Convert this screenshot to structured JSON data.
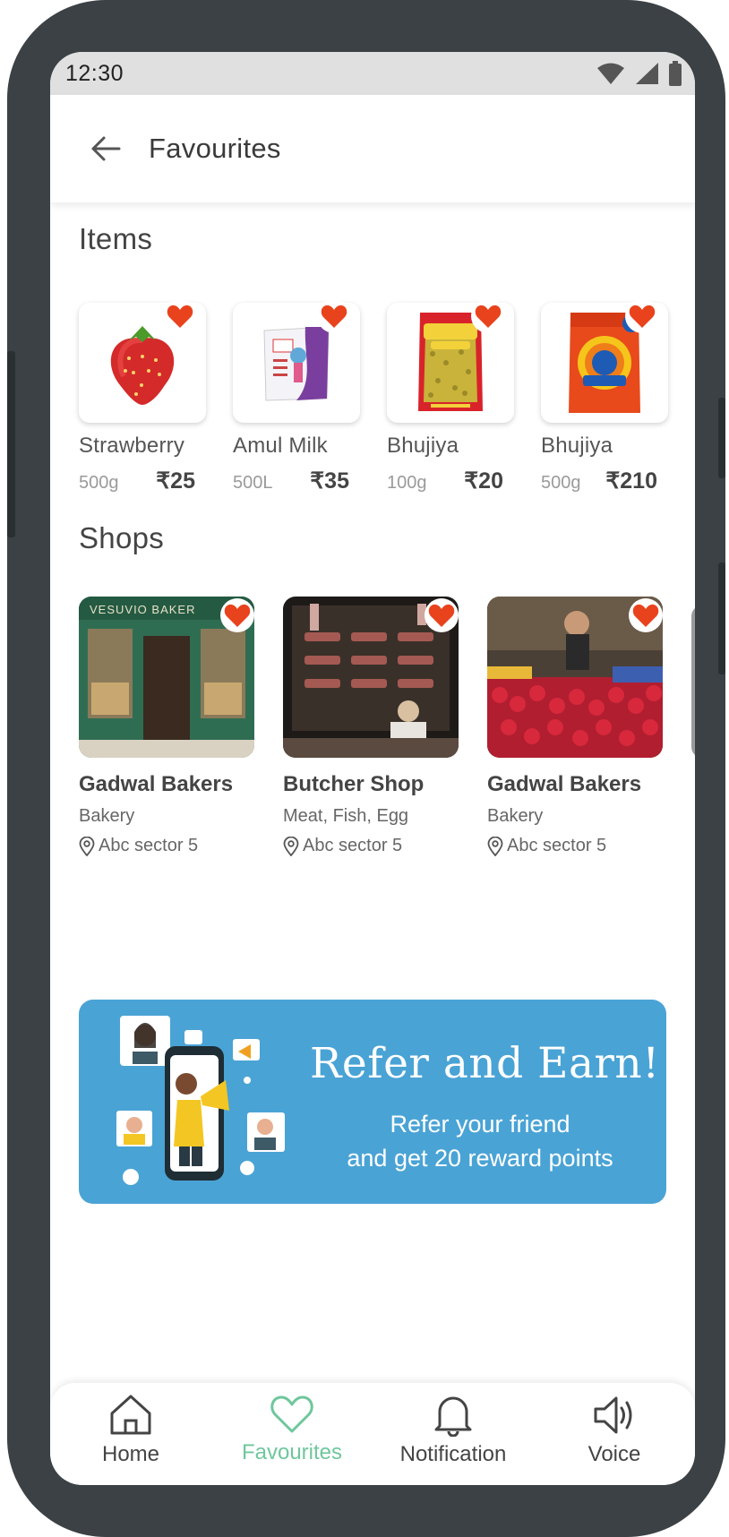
{
  "status_bar": {
    "time": "12:30"
  },
  "header": {
    "title": "Favourites"
  },
  "sections": {
    "items_title": "Items",
    "shops_title": "Shops"
  },
  "items": [
    {
      "name": "Strawberry",
      "qty": "500g",
      "price": "₹25"
    },
    {
      "name": "Amul Milk",
      "qty": "500L",
      "price": "₹35"
    },
    {
      "name": "Bhujiya",
      "qty": "100g",
      "price": "₹20"
    },
    {
      "name": "Bhujiya",
      "qty": "500g",
      "price": "₹210"
    }
  ],
  "shops": [
    {
      "name": "Gadwal Bakers",
      "category": "Bakery",
      "location": "Abc sector 5",
      "sign": "VESUVIO BAKER"
    },
    {
      "name": "Butcher Shop",
      "category": "Meat, Fish, Egg",
      "location": "Abc sector 5"
    },
    {
      "name": "Gadwal Bakers",
      "category": "Bakery",
      "location": "Abc sector 5"
    }
  ],
  "banner": {
    "title": "Refer and Earn!",
    "line1": "Refer your friend",
    "line2": "and get 20 reward points"
  },
  "nav": {
    "home": "Home",
    "favourites": "Favourites",
    "notification": "Notification",
    "voice": "Voice"
  },
  "colors": {
    "accent": "#6fc79c",
    "heart": "#e8431d",
    "banner": "#4aa3d5",
    "frame": "#3b4144"
  },
  "icons": [
    "back-arrow-icon",
    "wifi-icon",
    "signal-icon",
    "battery-icon",
    "heart-icon",
    "location-pin-icon",
    "home-icon",
    "bell-icon",
    "speaker-icon"
  ]
}
